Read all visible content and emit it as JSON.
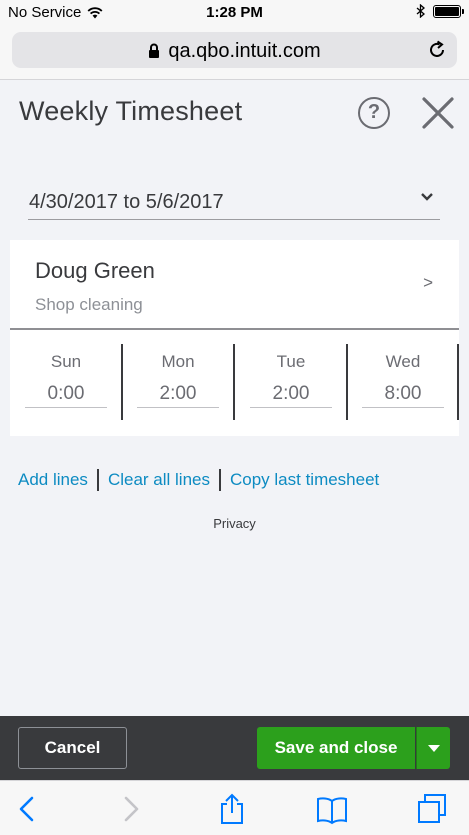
{
  "status_bar": {
    "carrier": "No Service",
    "time": "1:28 PM",
    "battery_level": 1.0
  },
  "browser": {
    "url": "qa.qbo.intuit.com",
    "icons": {
      "lock": "lock-icon",
      "reload": "reload-icon"
    }
  },
  "header": {
    "title": "Weekly Timesheet",
    "help_label": "?",
    "icons": {
      "help": "help-icon",
      "close": "close-icon"
    }
  },
  "date_range": {
    "value": "4/30/2017 to 5/6/2017"
  },
  "timesheet_row": {
    "employee": "Doug Green",
    "service": "Shop cleaning",
    "chevron": ">",
    "days": [
      {
        "label": "Sun",
        "value": "0:00"
      },
      {
        "label": "Mon",
        "value": "2:00"
      },
      {
        "label": "Tue",
        "value": "2:00"
      },
      {
        "label": "Wed",
        "value": "8:00"
      }
    ]
  },
  "actions": {
    "add_lines": "Add lines",
    "clear_all_lines": "Clear all lines",
    "copy_last_timesheet": "Copy last timesheet"
  },
  "footer": {
    "privacy": "Privacy"
  },
  "action_bar": {
    "cancel": "Cancel",
    "save_and_close": "Save and close"
  },
  "browser_toolbar": {
    "icons": [
      "back-icon",
      "forward-icon",
      "share-icon",
      "bookmarks-icon",
      "tabs-icon"
    ]
  },
  "colors": {
    "brand_green": "#2ca01c",
    "link_blue": "#0d8bc2",
    "action_bar": "#393a3d",
    "ios_blue": "#007aff"
  }
}
